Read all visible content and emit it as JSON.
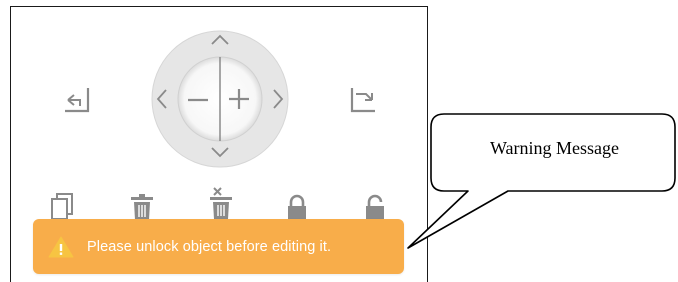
{
  "toolbar": {
    "rotate_left_icon": "rotate-left-icon",
    "rotate_right_icon": "rotate-right-icon",
    "copy_icon": "copy-icon",
    "delete_icon": "trash-icon",
    "delete_all_icon": "trash-cut-icon",
    "lock_icon": "lock-icon",
    "unlock_icon": "unlock-icon"
  },
  "joystick": {
    "up_icon": "chevron-up-icon",
    "down_icon": "chevron-down-icon",
    "left_icon": "chevron-left-icon",
    "right_icon": "chevron-right-icon",
    "zoom_out_icon": "minus-icon",
    "zoom_in_icon": "plus-icon"
  },
  "warning": {
    "icon": "warning-icon",
    "message": "Please unlock object before editing it.",
    "color": "#f8ad4a"
  },
  "callout": {
    "text": "Warning Message"
  },
  "colors": {
    "icon_gray": "#8a8a8a",
    "ring_gray": "#e3e3e3"
  }
}
